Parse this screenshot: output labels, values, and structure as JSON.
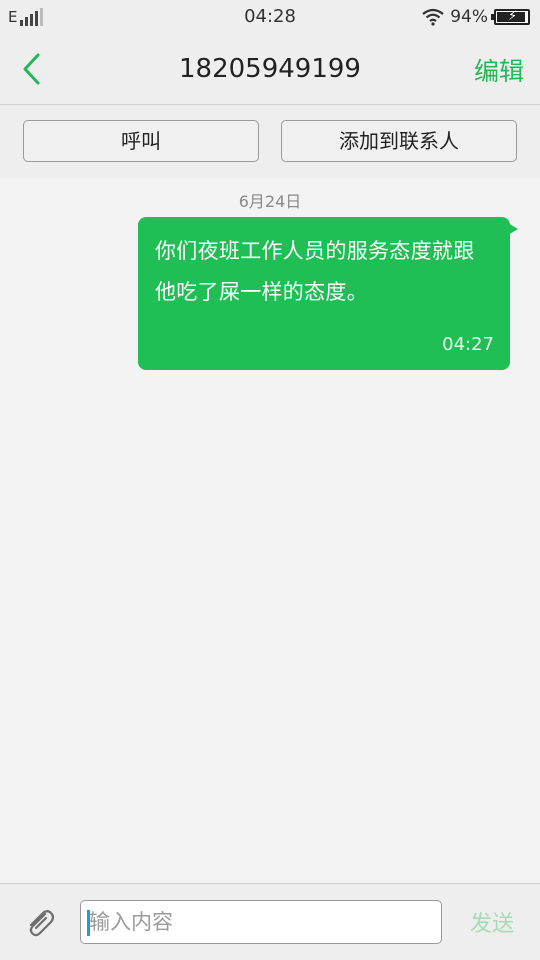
{
  "status_bar": {
    "network": "E",
    "time": "04:28",
    "battery_percent": "94%",
    "battery_level": 0.94,
    "wifi_icon": "wifi-icon",
    "battery_icon": "battery-charging-icon"
  },
  "header": {
    "back_icon": "chevron-left-icon",
    "title": "18205949199",
    "edit_label": "编辑"
  },
  "actions": {
    "call_label": "呼叫",
    "add_contact_label": "添加到联系人"
  },
  "thread": {
    "date": "6月24日",
    "messages": [
      {
        "direction": "outgoing",
        "text": "你们夜班工作人员的服务态度就跟他吃了屎一样的态度。",
        "time": "04:27"
      }
    ]
  },
  "composer": {
    "attach_icon": "paperclip-icon",
    "placeholder": "输入内容",
    "value": "",
    "send_label": "发送"
  },
  "colors": {
    "accent": "#21b958",
    "bubble": "#1fbf55",
    "send_disabled": "#a6dbb8"
  }
}
